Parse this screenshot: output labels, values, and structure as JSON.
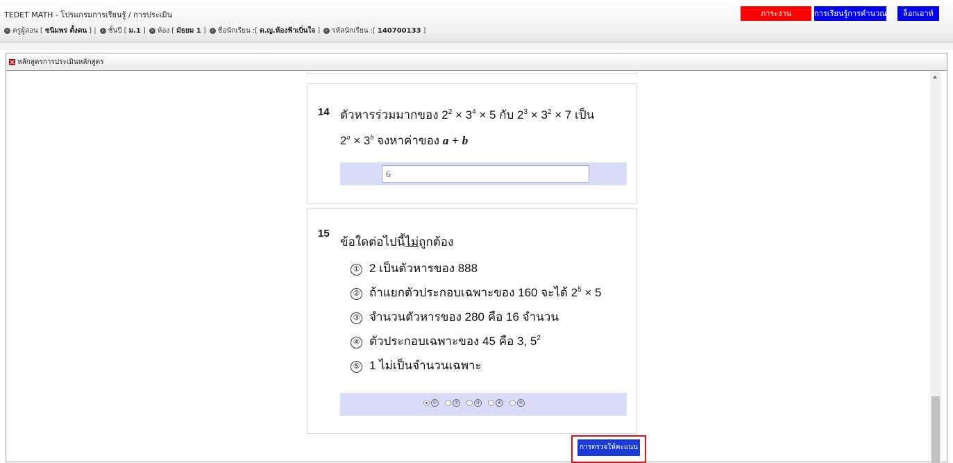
{
  "header": {
    "title": "TEDET MATH - โปรแกรมการเรียนรู้ / การประเมิน",
    "info": [
      {
        "label": "ครูผู้สอน",
        "value": "ชนิมพร ตั้งตน"
      },
      {
        "label": "ชั้นปี",
        "value": "ม.1"
      },
      {
        "label": "ห้อง",
        "value": "มัธยม 1"
      },
      {
        "label": "ชื่อนักเรียน",
        "value": "ด.ญ.ห้องฟ้าเบิ่นใจ"
      },
      {
        "label": "รหัสนักเรียน",
        "value": "140700133"
      }
    ],
    "buttons": {
      "homework": "ภาระงาน",
      "learning": "การเรียนรู้การคำนวณ",
      "logout": "ล็อกเอาท์"
    },
    "colors": {
      "homework": "#ff0000",
      "learning": "#0000ee",
      "logout": "#0000ee"
    }
  },
  "panel": {
    "title": "หลักสูตรการประเมินหลักสูตร",
    "close_icon": "close-icon"
  },
  "questions": [
    {
      "number": "14",
      "line1": "ตัวหารร่วมมากของ 2² × 3⁴ × 5 กับ 2³ × 3² × 7 เป็น",
      "line2": "2ᵃ × 3ᵇ จงหาค่าของ a + b",
      "answer_value": "6"
    },
    {
      "number": "15",
      "prompt": "ข้อใดต่อไปนี้ไม่ถูกต้อง",
      "choices": [
        "2 เป็นตัวหารของ 888",
        "ถ้าแยกตัวประกอบเฉพาะของ 160 จะได้ 2⁵ × 5",
        "จำนวนตัวหารของ 280 คือ 16 จำนวน",
        "ตัวประกอบเฉพาะของ 45 คือ 3, 5²",
        "1 ไม่เป็นจำนวนเฉพาะ"
      ],
      "choice_marks": [
        "①",
        "②",
        "③",
        "④",
        "⑤"
      ],
      "selected": "①"
    }
  ],
  "submit_label": "การตรวจให้คะแนน"
}
